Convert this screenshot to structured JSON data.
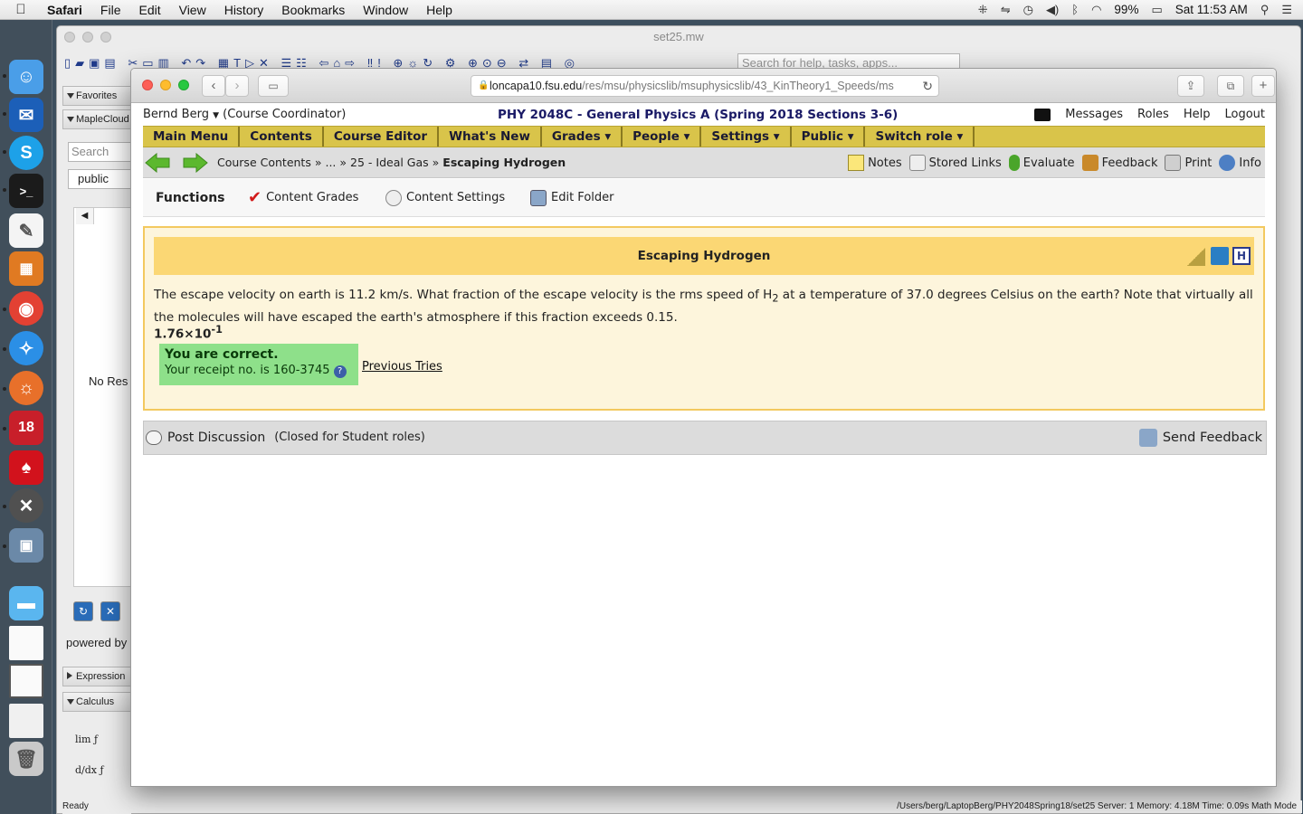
{
  "menubar": {
    "app": "Safari",
    "items": [
      "File",
      "Edit",
      "View",
      "History",
      "Bookmarks",
      "Window",
      "Help"
    ],
    "battery": "99%",
    "clock": "Sat 11:53 AM"
  },
  "maple": {
    "title": "set25.mw",
    "search_placeholder": "Search for help, tasks, apps...",
    "panels": {
      "favorites": "Favorites",
      "maplecloud": "MapleCloud",
      "expression": "Expression",
      "calculus": "Calculus"
    },
    "side_search": "Search",
    "side_public": "public",
    "no_results": "No Res",
    "powered_by": "powered by",
    "status_left": "Ready",
    "status_right": "/Users/berg/LaptopBerg/PHY2048Spring18/set25   Server: 1   Memory: 4.18M   Time: 0.09s   Math Mode"
  },
  "safari": {
    "url_domain": "loncapa10.fsu.edu",
    "url_path": "/res/msu/physicslib/msuphysicslib/43_KinTheory1_Speeds/ms"
  },
  "userbar": {
    "user": "Bernd Berg",
    "role": "(Course Coordinator)",
    "course": "PHY 2048C - General Physics A (Spring 2018 Sections 3-6)",
    "links": [
      "Messages",
      "Roles",
      "Help",
      "Logout"
    ]
  },
  "nav": [
    "Main Menu",
    "Contents",
    "Course Editor",
    "What's New",
    "Grades ▾",
    "People ▾",
    "Settings ▾",
    "Public ▾",
    "Switch role ▾"
  ],
  "breadcrumb": {
    "items": [
      "Course Contents",
      "...",
      "25 - Ideal Gas"
    ],
    "separator": "»",
    "current": "Escaping Hydrogen"
  },
  "tools": [
    "Notes",
    "Stored Links",
    "Evaluate",
    "Feedback",
    "Print",
    "Info"
  ],
  "functions": {
    "label": "Functions",
    "content_grades": "Content Grades",
    "content_settings": "Content Settings",
    "edit_folder": "Edit Folder"
  },
  "problem": {
    "title": "Escaping Hydrogen",
    "text_part1": "The escape velocity on earth is 11.2 km/s. What fraction of the escape velocity is the rms speed of H",
    "subscript": "2",
    "text_part2": " at a temperature of 37.0 degrees Celsius on the earth? Note that virtually all the molecules will have escaped the earth's atmosphere if this fraction exceeds 0.15.",
    "answer_mantissa": "1.76×10",
    "answer_exponent": "-1",
    "correct_label": "You are correct.",
    "receipt": "Your receipt no. is 160-3745",
    "previous_tries": "Previous Tries"
  },
  "discussion": {
    "post": "Post Discussion",
    "closed": "(Closed for Student roles)",
    "send_feedback": "Send Feedback"
  },
  "colors": {
    "nav_bg": "#d9c44a",
    "problem_header": "#fbd774",
    "problem_bg": "#fdf5dc",
    "correct_bg": "#8ee08a"
  }
}
